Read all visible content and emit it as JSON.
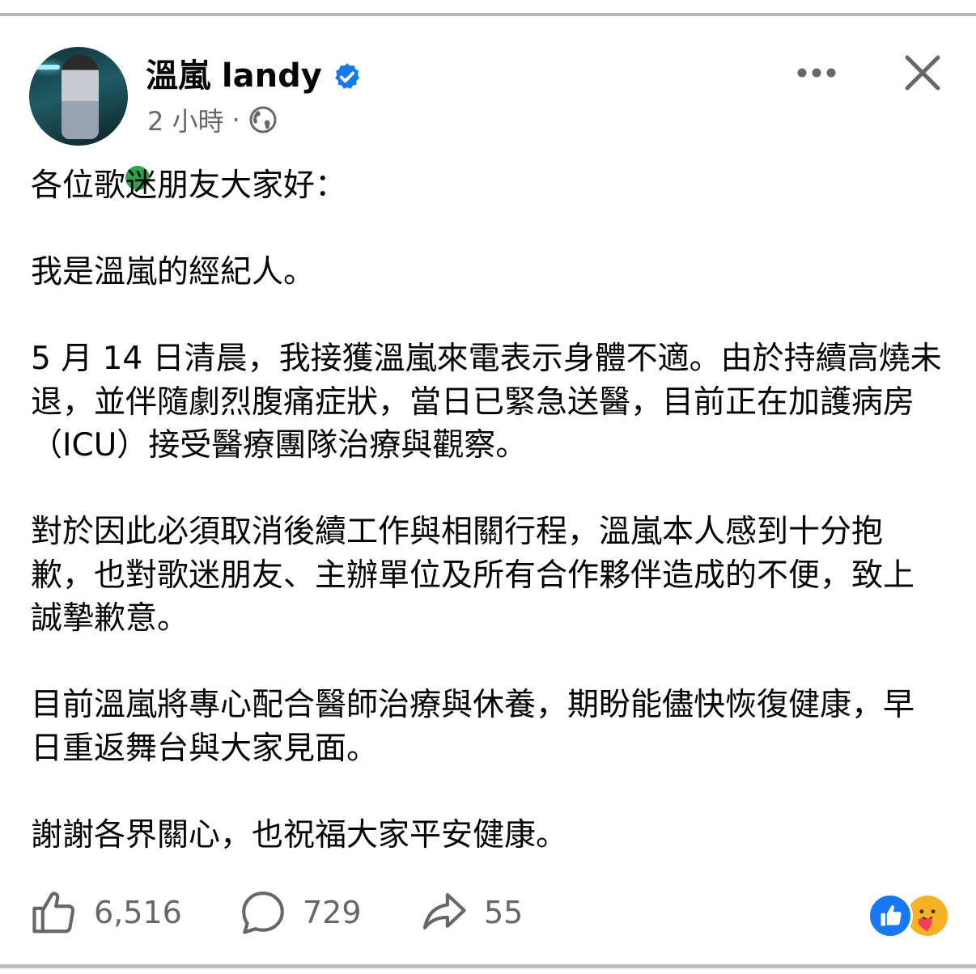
{
  "post": {
    "author_name": "溫嵐 landy",
    "timestamp": "2 小時",
    "separator": "·",
    "paragraphs": [
      "各位歌迷朋友大家好：",
      "我是溫嵐的經紀人。",
      "5 月 14 日清晨，我接獲溫嵐來電表示身體不適。由於持續高燒未退，並伴隨劇烈腹痛症狀，當日已緊急送醫，目前正在加護病房（ICU）接受醫療團隊治療與觀察。",
      "對於因此必須取消後續工作與相關行程，溫嵐本人感到十分抱歉，也對歌迷朋友、主辦單位及所有合作夥伴造成的不便，致上誠摯歉意。",
      "目前溫嵐將專心配合醫師治療與休養，期盼能儘快恢復健康，早日重返舞台與大家見面。",
      "謝謝各界關心，也祝福大家平安健康。"
    ]
  },
  "actions": {
    "like_count": "6,516",
    "comment_count": "729",
    "share_count": "55"
  },
  "icons": {
    "verified": "verified-badge-icon",
    "audience": "globe-icon",
    "more": "more-options-icon",
    "close": "close-icon",
    "like": "thumbs-up-icon",
    "comment": "comment-bubble-icon",
    "share": "share-arrow-icon",
    "reactions": [
      "like-reaction-icon",
      "care-reaction-icon"
    ]
  },
  "colors": {
    "verified_blue": "#1877f2",
    "online_green": "#31a24c",
    "secondary_text": "#65676b",
    "care_yellow": "#f7b125"
  }
}
